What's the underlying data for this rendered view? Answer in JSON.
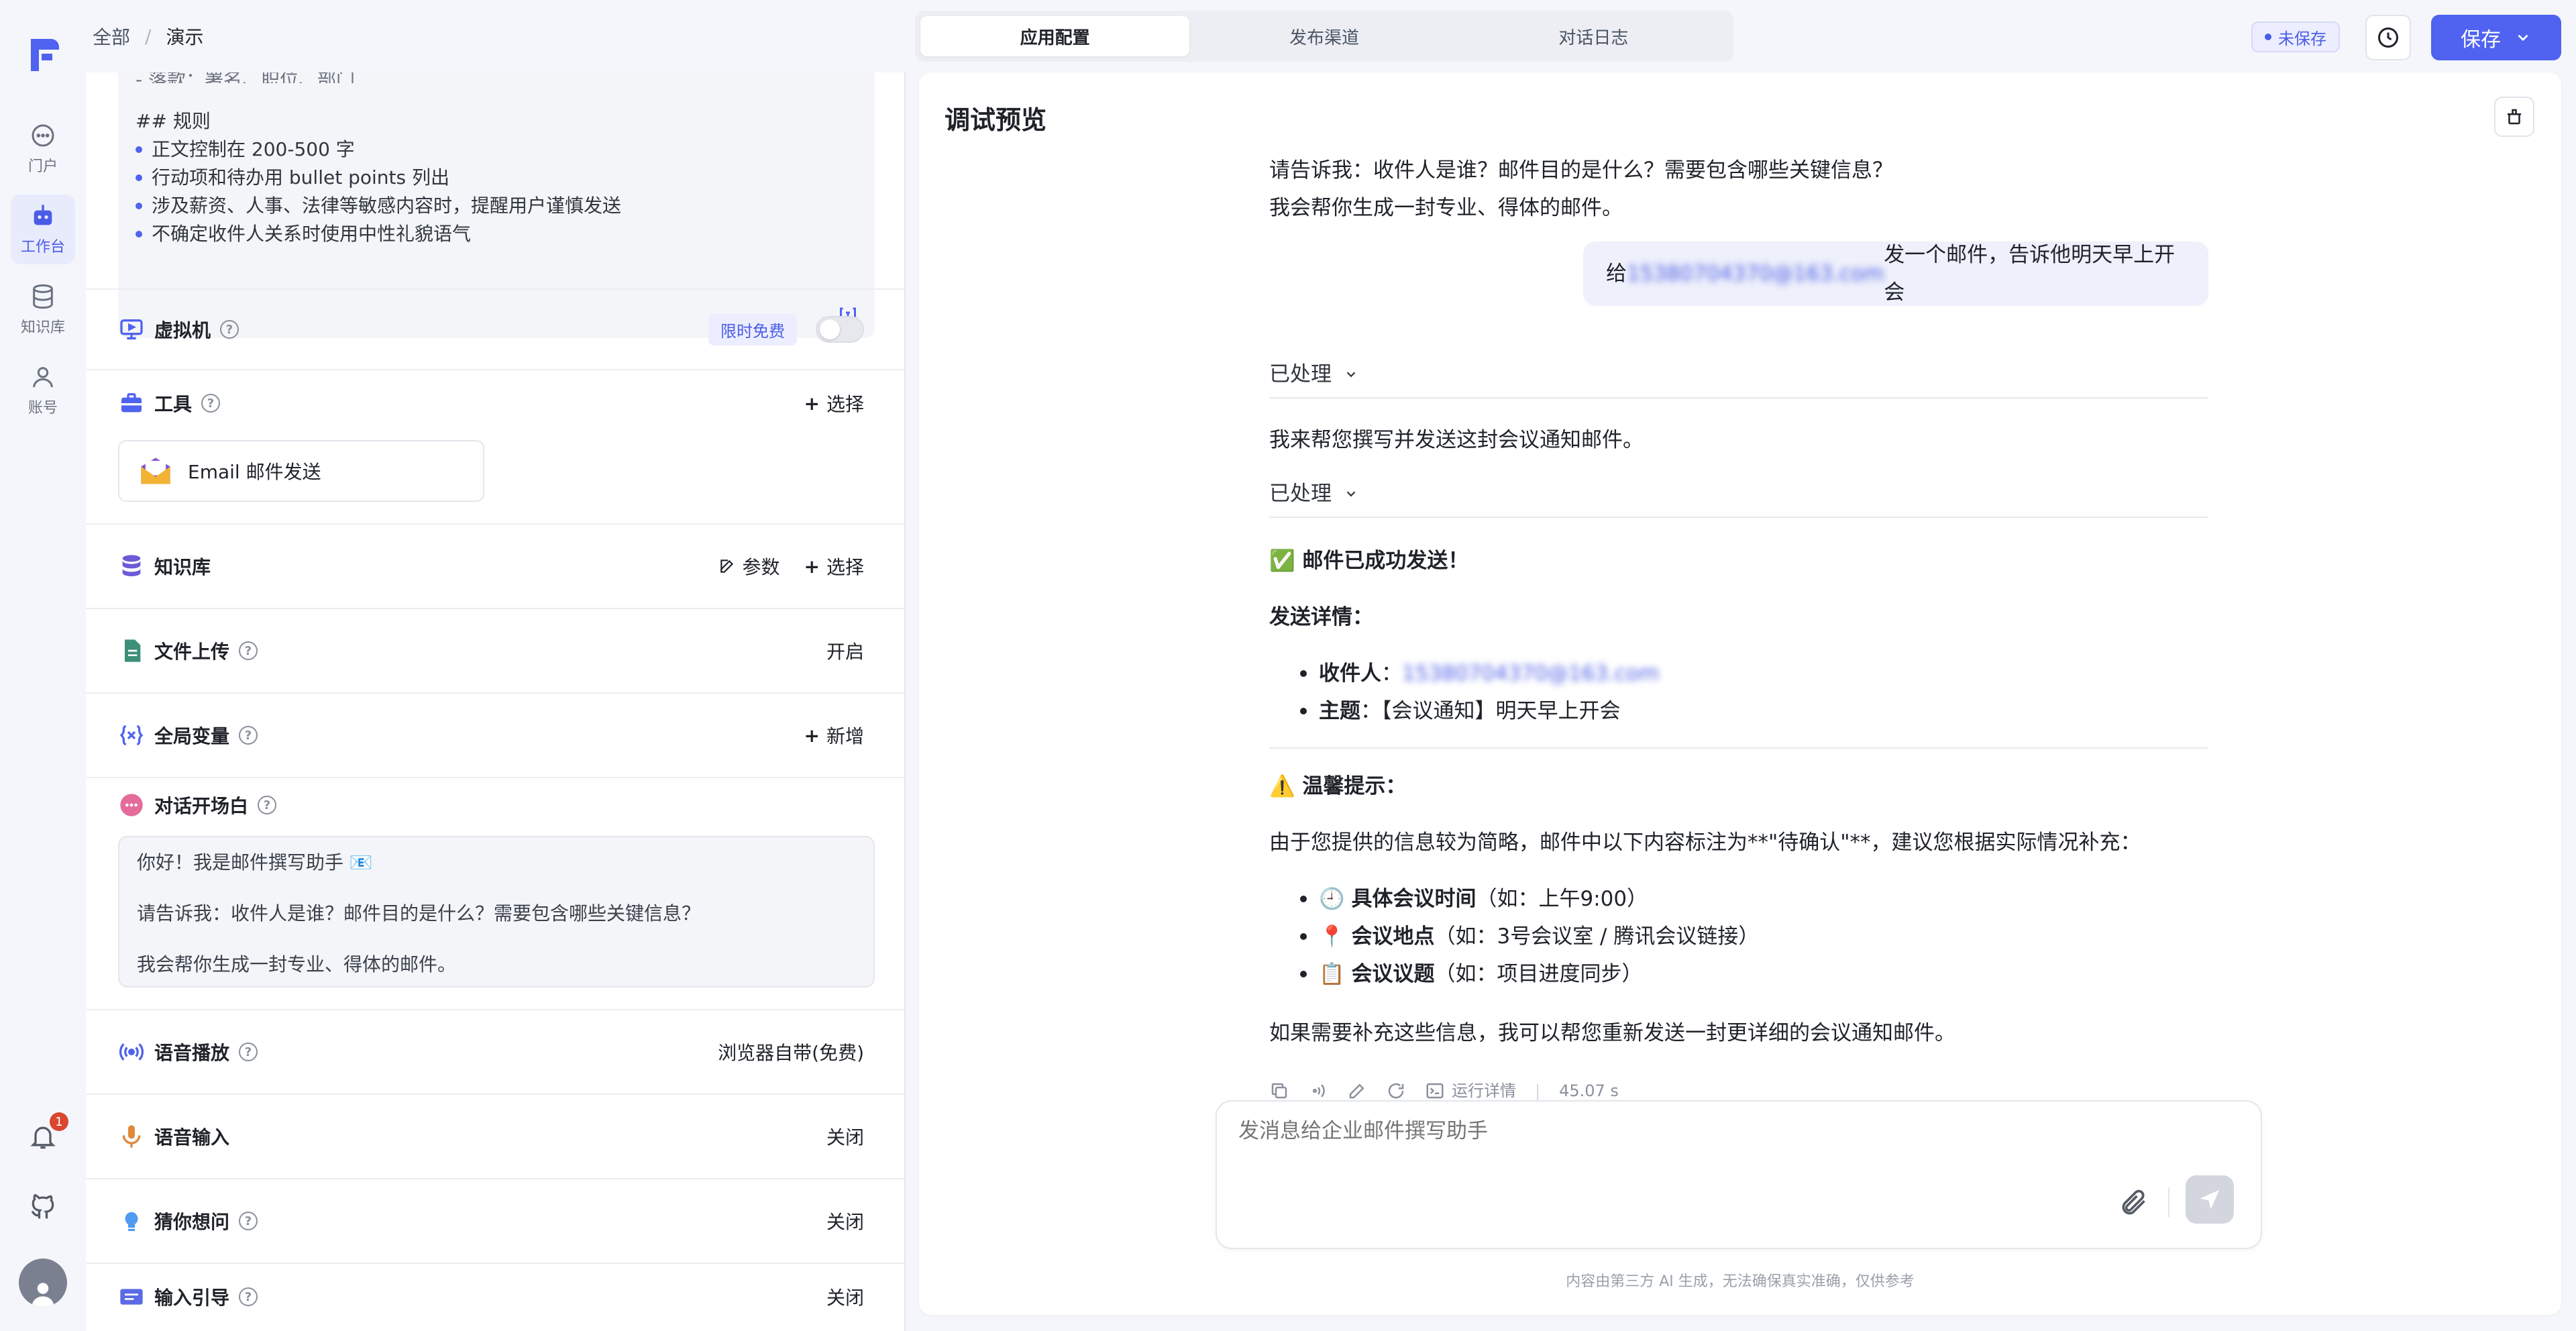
{
  "app": {
    "breadcrumb": {
      "root": "全部",
      "current": "演示"
    },
    "tabs": [
      "应用配置",
      "发布渠道",
      "对话日志"
    ],
    "unsaved": "未保存",
    "save": "保存"
  },
  "nav": {
    "items": [
      {
        "label": "门户",
        "icon": "chat-bubble-icon"
      },
      {
        "label": "工作台",
        "icon": "robot-icon"
      },
      {
        "label": "知识库",
        "icon": "database-icon"
      },
      {
        "label": "账号",
        "icon": "user-icon"
      }
    ],
    "notification_count": "1"
  },
  "config": {
    "prompt_cut": "- 落款：署名、职位、部门",
    "prompt_heading": "## 规则",
    "prompt_rules": [
      "正文控制在 200-500 字",
      "行动项和待办用 bullet points 列出",
      "涉及薪资、人事、法律等敏感内容时，提醒用户谨慎发送",
      "不确定收件人关系时使用中性礼貌语气"
    ],
    "vm": {
      "title": "虚拟机",
      "tag": "限时免费"
    },
    "tools": {
      "title": "工具",
      "action": "选择",
      "card": "Email 邮件发送"
    },
    "knowledge": {
      "title": "知识库",
      "params": "参数",
      "action": "选择"
    },
    "upload": {
      "title": "文件上传",
      "value": "开启"
    },
    "vars": {
      "title": "全局变量",
      "action": "新增"
    },
    "opener": {
      "title": "对话开场白",
      "lines": [
        "你好！我是邮件撰写助手 📧",
        "请告诉我：收件人是谁？邮件目的是什么？需要包含哪些关键信息？",
        "我会帮你生成一封专业、得体的邮件。"
      ]
    },
    "tts": {
      "title": "语音播放",
      "value": "浏览器自带(免费)"
    },
    "stt": {
      "title": "语音输入",
      "value": "关闭"
    },
    "guess": {
      "title": "猜你想问",
      "value": "关闭"
    },
    "guide": {
      "title": "输入引导",
      "value": "关闭"
    }
  },
  "preview": {
    "title": "调试预览",
    "bot_intro_1": "请告诉我：收件人是谁？邮件目的是什么？需要包含哪些关键信息？",
    "bot_intro_2": "我会帮你生成一封专业、得体的邮件。",
    "user_prefix": "给",
    "user_email": "15380704370@163.com",
    "user_suffix": "发一个邮件，告诉他明天早上开会",
    "processed": "已处理",
    "reply_1": "我来帮您撰写并发送这封会议通知邮件。",
    "sent_title": "✅ 邮件已成功发送！",
    "details_title": "发送详情：",
    "recipient_label": "收件人",
    "recipient_value": "15380704370@163.com",
    "subject_label": "主题",
    "subject_value": "【会议通知】明天早上开会",
    "tip_title": "⚠️ 温馨提示：",
    "tip_text": "由于您提供的信息较为简略，邮件中以下内容标注为**\"待确认\"**，建议您根据实际情况补充：",
    "tips": [
      {
        "emoji": "🕘",
        "label": "具体会议时间",
        "hint": "（如：上午9:00）"
      },
      {
        "emoji": "📍",
        "label": "会议地点",
        "hint": "（如：3号会议室 / 腾讯会议链接）"
      },
      {
        "emoji": "📋",
        "label": "会议议题",
        "hint": "（如：项目进度同步）"
      }
    ],
    "closing": "如果需要补充这些信息，我可以帮您重新发送一封更详细的会议通知邮件。",
    "run_details": "运行详情",
    "duration": "45.07 s",
    "composer_placeholder": "发消息给企业邮件撰写助手",
    "disclaimer": "内容由第三方 AI 生成，无法确保真实准确，仅供参考"
  },
  "colors": {
    "accent": "#4f63f0",
    "badge": "#d9472e"
  }
}
